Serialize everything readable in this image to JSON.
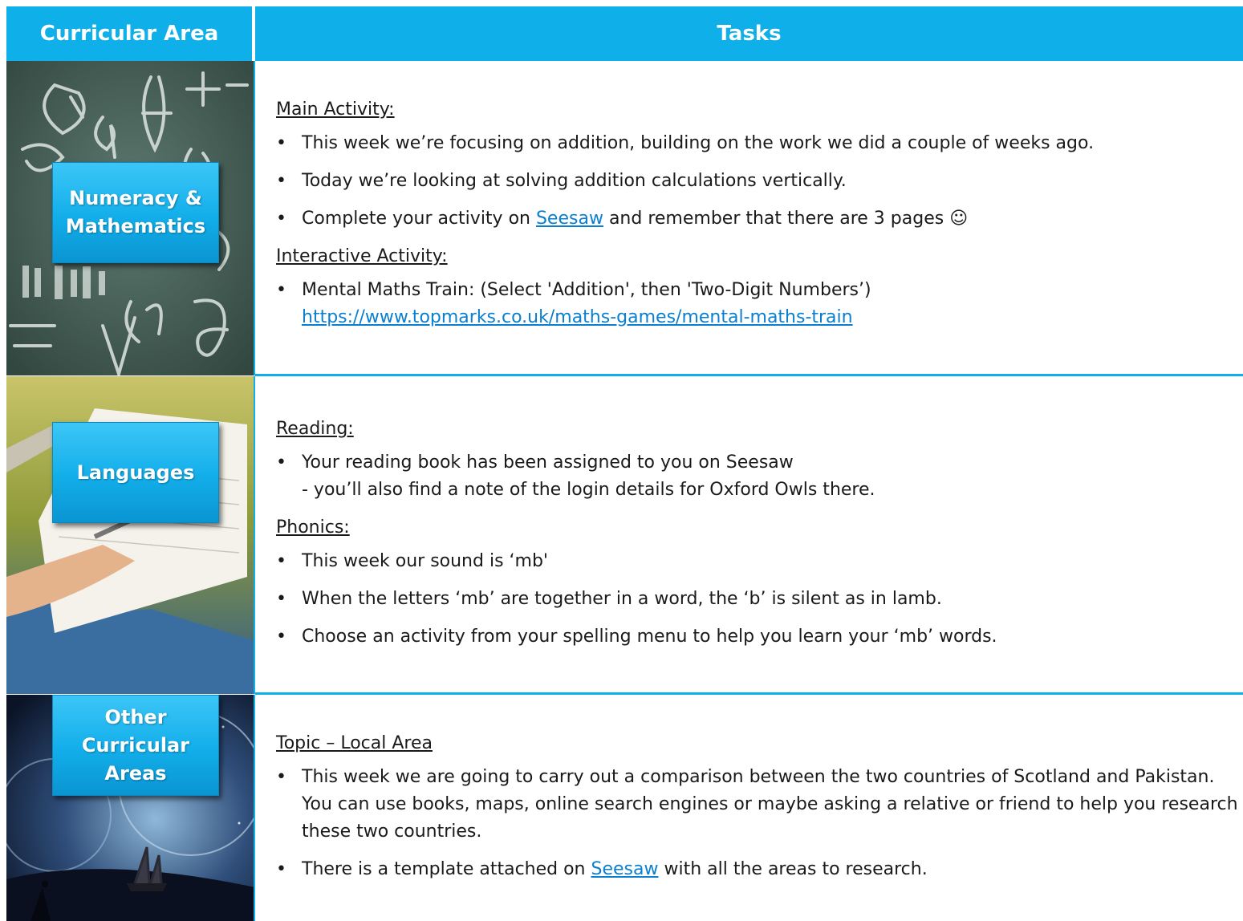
{
  "header": {
    "col1": "Curricular Area",
    "col2": "Tasks"
  },
  "rows": [
    {
      "area": [
        "Numeracy &",
        "Mathematics"
      ],
      "sections": [
        {
          "title": "Main Activity:",
          "items": [
            {
              "text": "This week we’re focusing on addition, building on the work we did a couple of weeks ago."
            },
            {
              "text": "Today we’re looking at solving addition calculations vertically."
            },
            {
              "before": "Complete your activity on ",
              "link": "Seesaw",
              "after": " and remember that there are 3 pages ☺"
            }
          ]
        },
        {
          "title": "Interactive Activity:",
          "items": [
            {
              "text": "Mental Maths Train: (Select 'Addition', then 'Two-Digit Numbers’)",
              "url": "https://www.topmarks.co.uk/maths-games/mental-maths-train"
            }
          ]
        }
      ]
    },
    {
      "area": [
        "Languages"
      ],
      "sections": [
        {
          "title": "Reading:",
          "items": [
            {
              "text": "Your reading book has been assigned to you on Seesaw",
              "sub": "- you’ll also find a note of the login details for Oxford Owls there."
            }
          ]
        },
        {
          "title": "Phonics:",
          "items": [
            {
              "text": "This week our sound is ‘mb'"
            },
            {
              "text": "When the letters ‘mb’ are together in a word, the ‘b’ is silent as in lamb."
            },
            {
              "text": "Choose an activity from your spelling menu to help you learn your ‘mb’ words."
            }
          ]
        }
      ]
    },
    {
      "area": [
        "Other",
        "Curricular",
        "Areas"
      ],
      "sections": [
        {
          "title": "Topic – Local Area",
          "items": [
            {
              "text": "This week we are going to carry out a comparison between the two countries of Scotland and Pakistan. You can use books, maps, online search engines or maybe asking a relative or friend to help you research these two countries."
            },
            {
              "before": "There is a template attached on ",
              "link": "Seesaw",
              "after": " with all the areas to research."
            }
          ]
        }
      ]
    }
  ]
}
